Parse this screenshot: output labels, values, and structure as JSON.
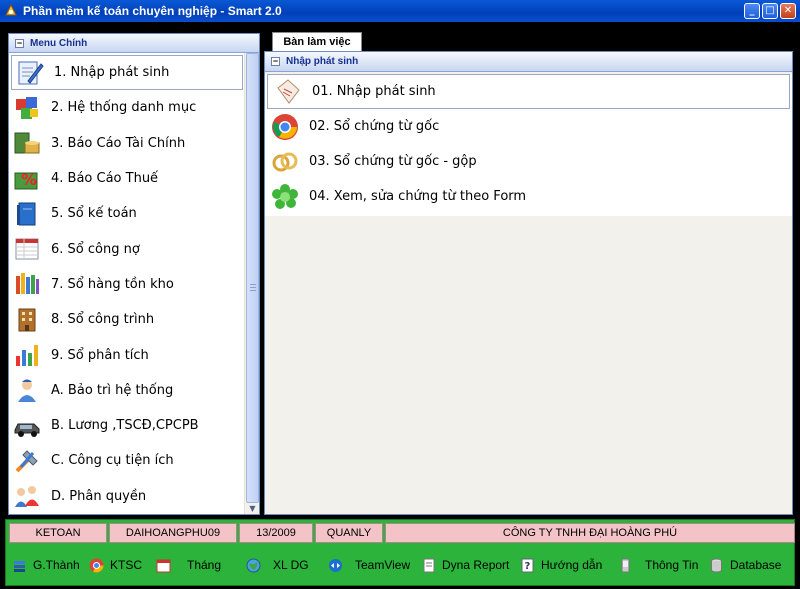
{
  "window": {
    "title": "Phần mềm kế toán chuyên nghiệp - Smart 2.0"
  },
  "left_panel": {
    "header": "Menu Chính",
    "items": [
      {
        "label": "1. Nhập phát sinh",
        "icon": "notepad-pen-icon"
      },
      {
        "label": "2. Hệ thống danh mục",
        "icon": "cubes-icon"
      },
      {
        "label": "3. Báo Cáo Tài Chính",
        "icon": "money-stack-icon"
      },
      {
        "label": "4. Báo Cáo Thuế",
        "icon": "percent-icon"
      },
      {
        "label": "5. Sổ kế toán",
        "icon": "book-icon"
      },
      {
        "label": "6. Sổ công nợ",
        "icon": "spreadsheet-icon"
      },
      {
        "label": "7. Sổ hàng tồn kho",
        "icon": "books-shelf-icon"
      },
      {
        "label": "8. Sổ công trình",
        "icon": "building-icon"
      },
      {
        "label": "9. Sổ phân tích",
        "icon": "bar-chart-icon"
      },
      {
        "label": "A. Bảo trì hệ thống",
        "icon": "technician-icon"
      },
      {
        "label": "B. Lương ,TSCĐ,CPCPB",
        "icon": "car-icon"
      },
      {
        "label": "C. Công cụ tiện ích",
        "icon": "tools-icon"
      },
      {
        "label": "D. Phân quyền",
        "icon": "users-icon"
      }
    ]
  },
  "tab": {
    "label": "Bàn làm việc"
  },
  "right_panel": {
    "header": "Nhập phát sinh",
    "items": [
      {
        "label": "01. Nhập phát sinh",
        "icon": "document-icon"
      },
      {
        "label": "02. Sổ chứng từ gốc",
        "icon": "chrome-icon"
      },
      {
        "label": "03. Sổ chứng từ gốc - gộp",
        "icon": "rings-icon"
      },
      {
        "label": "04. Xem, sửa chứng từ  theo Form",
        "icon": "green-flower-icon"
      }
    ]
  },
  "status": {
    "user": "KETOAN",
    "database": "DAIHOANGPHU09",
    "period": "13/2009",
    "role": "QUANLY",
    "company": "CÔNG TY TNHH ĐẠI HOÀNG PHÚ"
  },
  "toolbar": {
    "items": [
      {
        "label": "G.Thành",
        "icon": "stack-icon"
      },
      {
        "label": "KTSC",
        "icon": "chrome-icon"
      },
      {
        "label": "Tháng",
        "icon": "calendar-icon"
      },
      {
        "label": "XL DG",
        "icon": "globe-icon"
      },
      {
        "label": "TeamView",
        "icon": "teamviewer-icon"
      },
      {
        "label": "Dyna Report",
        "icon": "report-icon"
      },
      {
        "label": "Hướng dẫn",
        "icon": "help-icon"
      },
      {
        "label": "Thông Tin",
        "icon": "info-icon"
      },
      {
        "label": "Database",
        "icon": "database-icon"
      }
    ]
  },
  "colors": {
    "titlebar": "#0a58d6",
    "statusbar": "#2bb33b",
    "status_cell": "#f4c3c7"
  }
}
